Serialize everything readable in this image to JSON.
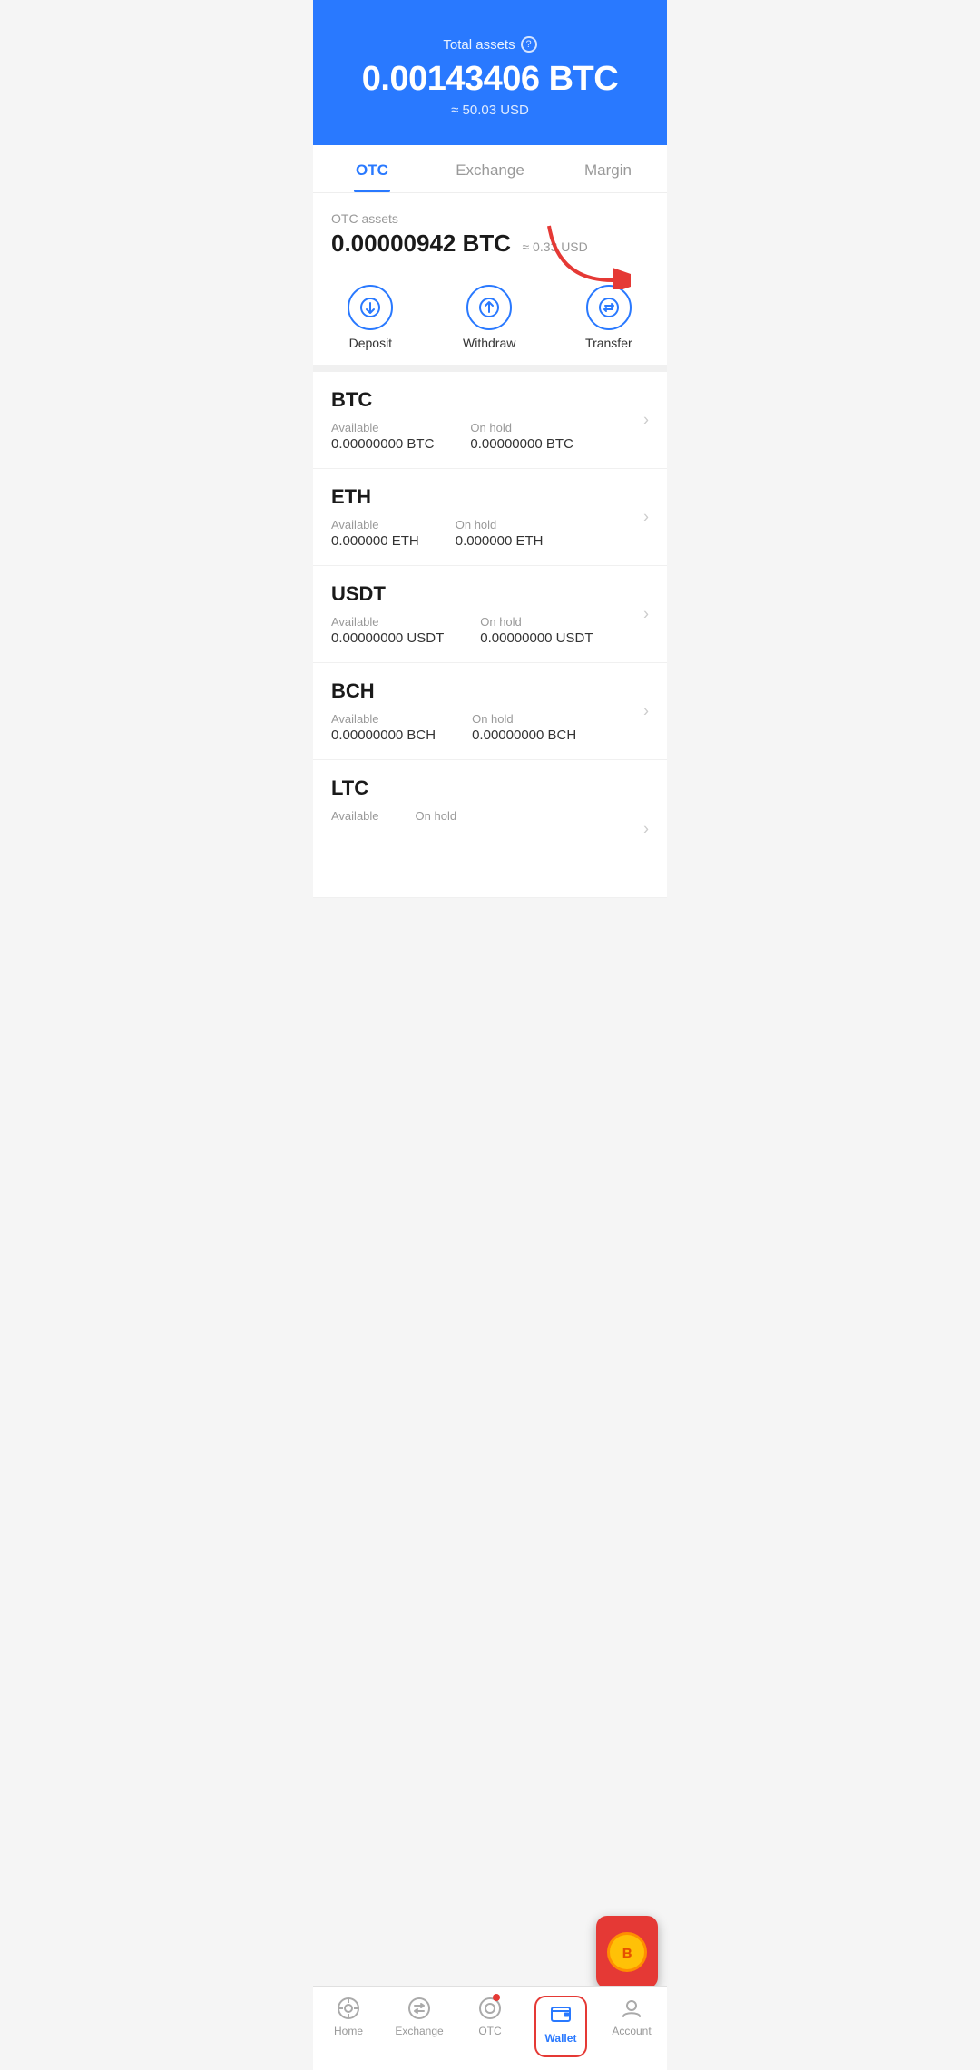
{
  "header": {
    "total_assets_label": "Total assets",
    "help_icon": "?",
    "total_amount": "0.00143406 BTC",
    "total_usd": "≈ 50.03 USD"
  },
  "tabs": [
    {
      "id": "otc",
      "label": "OTC",
      "active": true
    },
    {
      "id": "exchange",
      "label": "Exchange",
      "active": false
    },
    {
      "id": "margin",
      "label": "Margin",
      "active": false
    }
  ],
  "otc_section": {
    "assets_label": "OTC assets",
    "amount": "0.00000942 BTC",
    "usd": "≈ 0.33 USD"
  },
  "actions": [
    {
      "id": "deposit",
      "label": "Deposit",
      "icon": "↓"
    },
    {
      "id": "withdraw",
      "label": "Withdraw",
      "icon": "↑"
    },
    {
      "id": "transfer",
      "label": "Transfer",
      "icon": "⇌"
    }
  ],
  "currencies": [
    {
      "name": "BTC",
      "available_label": "Available",
      "available_value": "0.00000000 BTC",
      "onhold_label": "On hold",
      "onhold_value": "0.00000000 BTC"
    },
    {
      "name": "ETH",
      "available_label": "Available",
      "available_value": "0.000000 ETH",
      "onhold_label": "On hold",
      "onhold_value": "0.000000 ETH"
    },
    {
      "name": "USDT",
      "available_label": "Available",
      "available_value": "0.00000000 USDT",
      "onhold_label": "On hold",
      "onhold_value": "0.00000000 USDT"
    },
    {
      "name": "BCH",
      "available_label": "Available",
      "available_value": "0.00000000 BCH",
      "onhold_label": "On hold",
      "onhold_value": "0.00000000 BCH"
    },
    {
      "name": "LTC",
      "available_label": "Available",
      "available_value": "",
      "onhold_label": "On hold",
      "onhold_value": ""
    }
  ],
  "bottom_nav": [
    {
      "id": "home",
      "label": "Home",
      "active": false
    },
    {
      "id": "exchange",
      "label": "Exchange",
      "active": false
    },
    {
      "id": "otc",
      "label": "OTC",
      "active": false,
      "has_dot": true
    },
    {
      "id": "wallet",
      "label": "Wallet",
      "active": true
    },
    {
      "id": "account",
      "label": "Account",
      "active": false
    }
  ],
  "colors": {
    "primary": "#2979ff",
    "danger": "#e53935",
    "text_dark": "#1a1a1a",
    "text_muted": "#999",
    "border": "#f0f0f0"
  }
}
